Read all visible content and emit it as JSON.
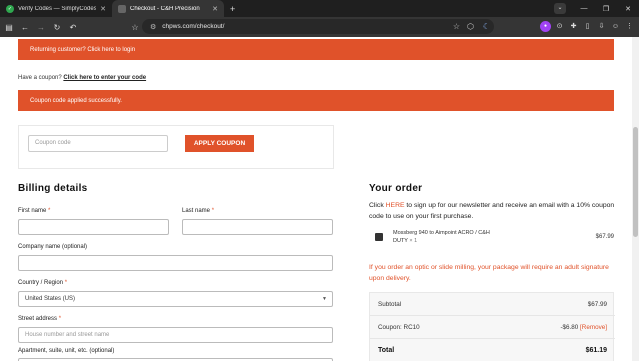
{
  "browser": {
    "tabs": [
      {
        "title": "Verify Codes — SimplyCodes",
        "icon": "check-circle-icon"
      },
      {
        "title": "Checkout - C&H Precision",
        "icon": "site-favicon"
      }
    ],
    "url": "chpws.com/checkout/"
  },
  "notices": {
    "returning": "Returning customer? Click here to login",
    "coupon_prompt": "Have a coupon?",
    "coupon_link": "Click here to enter your code",
    "coupon_applied": "Coupon code applied successfully."
  },
  "coupon": {
    "placeholder": "Coupon code",
    "button": "APPLY COUPON"
  },
  "billing": {
    "heading": "Billing details",
    "first_name": "First name",
    "last_name": "Last name",
    "company": "Company name (optional)",
    "country_label": "Country / Region",
    "country_value": "United States (US)",
    "street_label": "Street address",
    "street_placeholder": "House number and street name",
    "apartment_label": "Apartment, suite, unit, etc. (optional)",
    "required_mark": "*"
  },
  "order": {
    "heading": "Your order",
    "intro_prefix": "Click ",
    "intro_link": "HERE",
    "intro_suffix": " to sign up for our newsletter and receive an email with a 10% coupon code to use on your first purchase.",
    "product_name": "Mossberg 940 to Aimpoint ACRO / C&H DUTY",
    "product_qty": "× 1",
    "product_price": "$67.99",
    "warning": "If you order an optic or slide milling, your package will require an adult signature upon delivery.",
    "subtotal_label": "Subtotal",
    "subtotal_value": "$67.99",
    "coupon_label": "Coupon: RC10",
    "coupon_value": "-$6.80",
    "coupon_remove": "[Remove]",
    "total_label": "Total",
    "total_value": "$61.19"
  },
  "colors": {
    "accent": "#e0522a"
  }
}
